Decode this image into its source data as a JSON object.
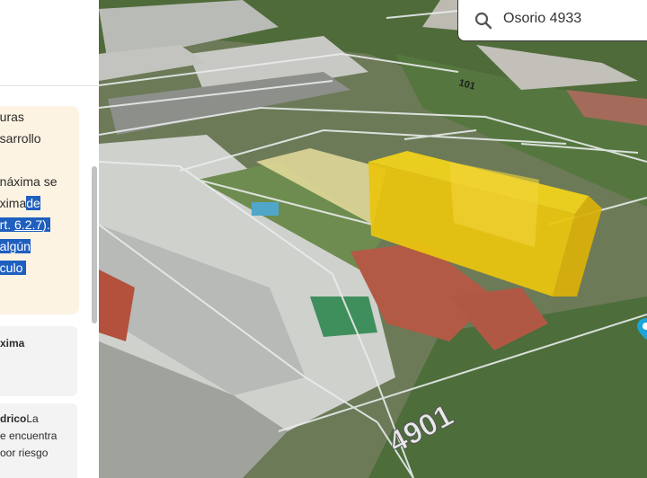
{
  "search": {
    "value": "Osorio 4933",
    "placeholder": ""
  },
  "note_lines": [
    {
      "text": "uras"
    },
    {
      "text": "sarrollo"
    },
    {
      "text": ""
    },
    {
      "text": "náxima se"
    },
    {
      "plain": "xima",
      "hl": "de"
    },
    {
      "hl_prefix": "rt. ",
      "hl_link": "6.2.7",
      "hl_suffix": ")."
    },
    {
      "hl": "algún"
    },
    {
      "hl": "culo"
    }
  ],
  "cards": [
    {
      "lines": [
        "xima"
      ]
    },
    {
      "bold": "drico",
      "lines": [
        "La",
        "e encuentra",
        "oor riesgo"
      ]
    }
  ],
  "map_labels": {
    "street_top": "101",
    "street_bottom": "4901"
  },
  "colors": {
    "volume": "#f2c80f",
    "highlight": "#1f5fbf",
    "note_bg": "#fdf3e2",
    "pin": "#1aa6d9"
  }
}
